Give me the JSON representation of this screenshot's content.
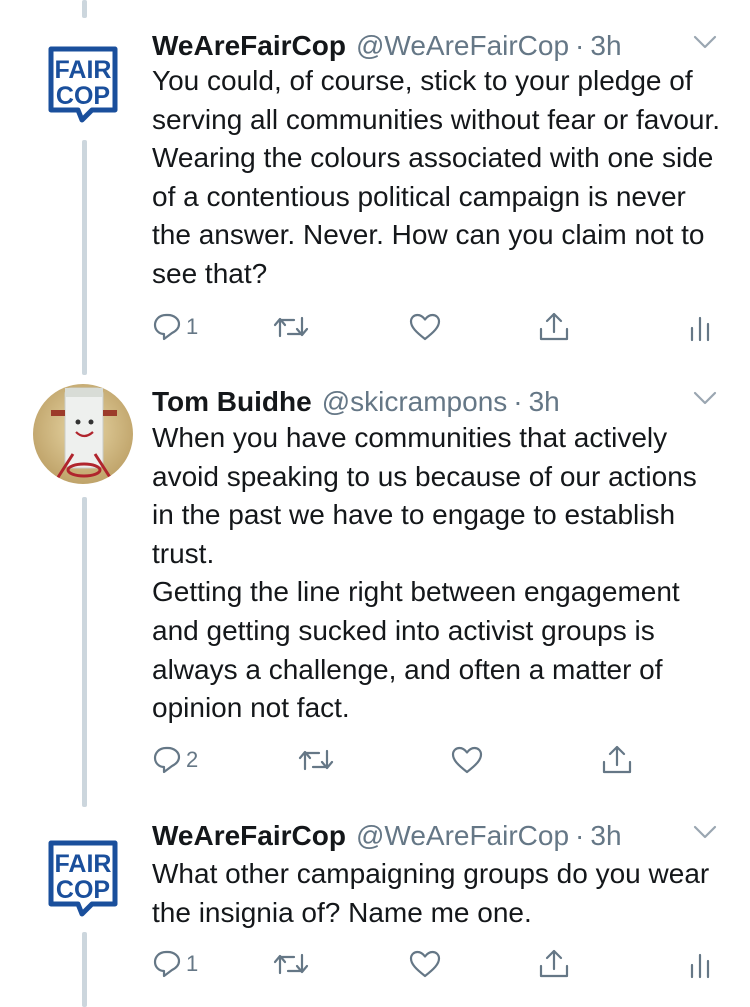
{
  "thread": {
    "tweets": [
      {
        "author": {
          "name": "WeAreFairCop",
          "handle": "@WeAreFairCop",
          "avatar_icon": "fair-cop-logo",
          "logo_lines": [
            "FAIR",
            "COP"
          ]
        },
        "separator": "·",
        "time": "3h",
        "paragraphs": [
          "You could, of course, stick to your pledge of serving all communities without fear or favour. Wearing the colours associated with one side of a contentious political campaign is never the answer. Never. How can you claim not to see that?"
        ],
        "reply_count": "1",
        "show_analytics": true,
        "show_share": true
      },
      {
        "author": {
          "name": "Tom Buidhe",
          "handle": "@skicrampons",
          "avatar_icon": "profile-photo"
        },
        "separator": "·",
        "time": "3h",
        "paragraphs": [
          "When you have communities that actively avoid speaking to us because of our actions in the past we have to engage to establish trust.",
          "Getting the line right between engagement and getting sucked into activist groups is always a challenge, and often a matter of opinion not fact."
        ],
        "reply_count": "2",
        "show_analytics": false,
        "show_share": true
      },
      {
        "author": {
          "name": "WeAreFairCop",
          "handle": "@WeAreFairCop",
          "avatar_icon": "fair-cop-logo",
          "logo_lines": [
            "FAIR",
            "COP"
          ]
        },
        "separator": "·",
        "time": "3h",
        "paragraphs": [
          "What other campaigning groups do you wear the insignia of? Name me one."
        ],
        "reply_count": "1",
        "show_analytics": true,
        "show_share": true
      }
    ]
  },
  "colors": {
    "brand_blue": "#1a4f9c",
    "secondary_text": "#657786",
    "primary_text": "#14171a",
    "thread_line": "#ccd6dd"
  }
}
